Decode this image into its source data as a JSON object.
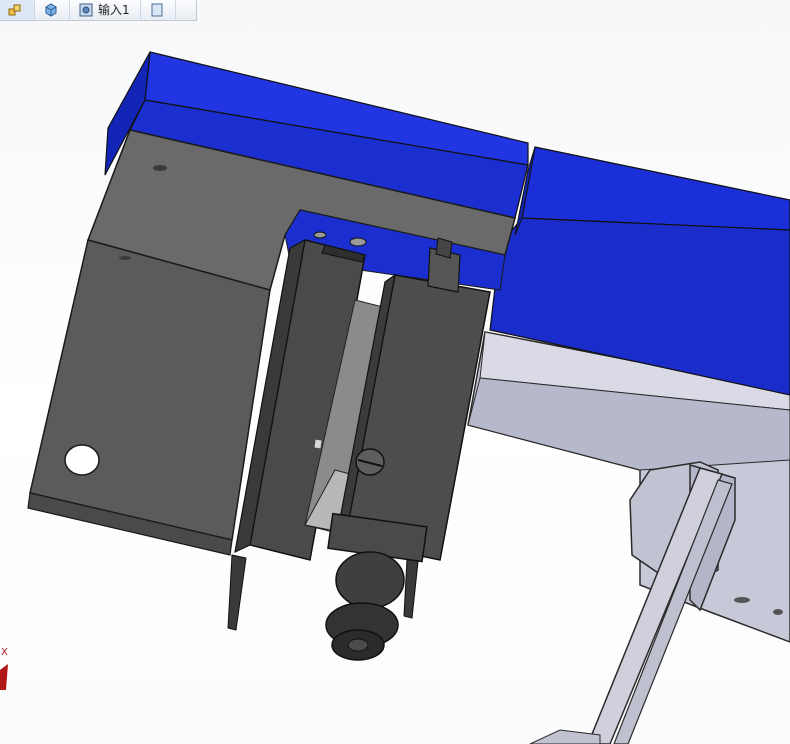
{
  "breadcrumb": {
    "items": [
      {
        "icon": "assembly-icon",
        "label": ""
      },
      {
        "icon": "part-icon",
        "label": ""
      },
      {
        "icon": "feature-icon",
        "label": "输入1"
      },
      {
        "icon": "sketch-plane-icon",
        "label": ""
      }
    ]
  },
  "triad": {
    "x_label": "X"
  },
  "colors": {
    "blue_body": "#1a2fd6",
    "dark_grey": "#5b5b5b",
    "light_grey": "#c9cad8",
    "background": "#ffffff"
  }
}
